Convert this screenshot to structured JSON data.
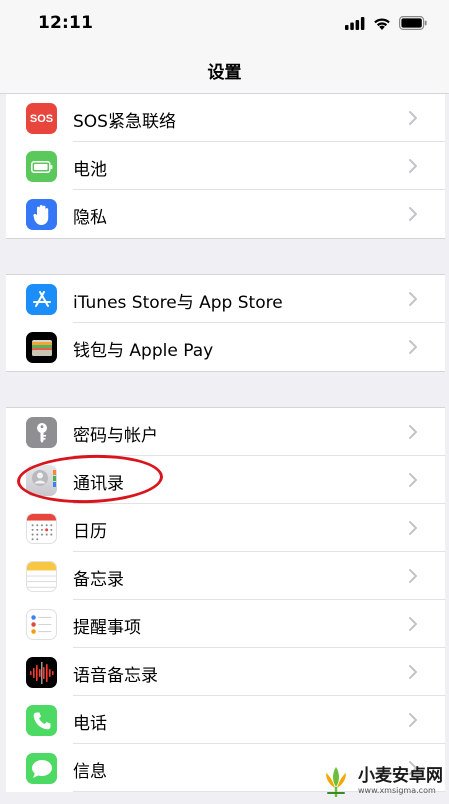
{
  "status": {
    "time": "12:11"
  },
  "nav": {
    "title": "设置"
  },
  "group1": [
    {
      "name": "sos",
      "label": "SOS紧急联络",
      "icon_text": "SOS",
      "color": "#e8453c"
    },
    {
      "name": "battery",
      "label": "电池",
      "color": "#5ac85a"
    },
    {
      "name": "privacy",
      "label": "隐私",
      "color": "#3478f6"
    }
  ],
  "group2": [
    {
      "name": "appstore",
      "label": "iTunes Store与 App Store",
      "color": "#1c8ef9"
    },
    {
      "name": "wallet",
      "label": "钱包与 Apple Pay",
      "color": "#000000"
    }
  ],
  "group3": [
    {
      "name": "passwords",
      "label": "密码与帐户",
      "color": "#8e8e93"
    },
    {
      "name": "contacts",
      "label": "通讯录",
      "color": "#d4d4d8"
    },
    {
      "name": "calendar",
      "label": "日历",
      "color": "#ffffff"
    },
    {
      "name": "notes",
      "label": "备忘录",
      "color": "#ffffff"
    },
    {
      "name": "reminders",
      "label": "提醒事项",
      "color": "#ffffff"
    },
    {
      "name": "voice-memos",
      "label": "语音备忘录",
      "color": "#000000"
    },
    {
      "name": "phone",
      "label": "电话",
      "color": "#4cd964"
    },
    {
      "name": "messages",
      "label": "信息",
      "color": "#4cd964"
    }
  ],
  "watermark": {
    "title": "小麦安卓网",
    "url": "www.xmsigma.com"
  }
}
